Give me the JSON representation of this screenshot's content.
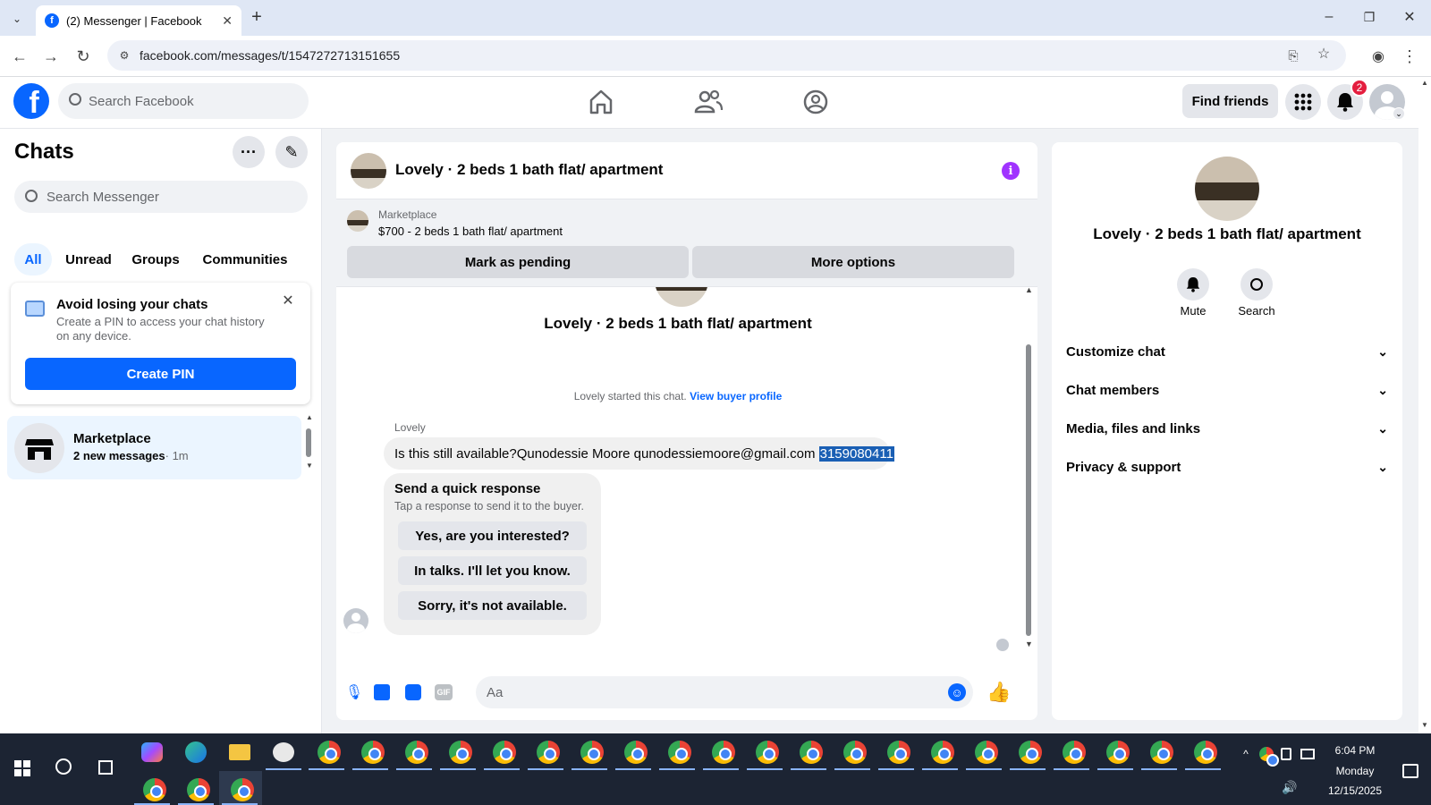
{
  "browser": {
    "tab_title": "(2) Messenger | Facebook",
    "url": "facebook.com/messages/t/1547272713151655"
  },
  "facebook": {
    "search_placeholder": "Search Facebook",
    "find_friends_label": "Find friends",
    "notification_count": "2"
  },
  "chats": {
    "title": "Chats",
    "search_placeholder": "Search Messenger",
    "filters": [
      "All",
      "Unread",
      "Groups",
      "Communities"
    ],
    "pin_card": {
      "title": "Avoid losing your chats",
      "body": "Create a PIN to access your chat history on any device.",
      "button": "Create PIN"
    },
    "conversations": [
      {
        "name": "Marketplace",
        "preview": "2 new messages",
        "time": "· 1m"
      }
    ]
  },
  "conversation": {
    "title": "Lovely · 2 beds 1 bath flat/ apartment",
    "marketplace_label": "Marketplace",
    "listing": "$700 - 2 beds 1 bath flat/ apartment",
    "mark_pending": "Mark as pending",
    "more_options": "More options",
    "intro_title": "Lovely · 2 beds 1 bath flat/ apartment",
    "started_text": "Lovely started this chat.",
    "view_buyer_profile": "View buyer profile",
    "sender_name": "Lovely",
    "message_text": "Is this still available?Qunodessie Moore qunodessiemoore@gmail.com ",
    "message_highlight": "3159080411",
    "quick_response": {
      "title": "Send a quick response",
      "subtitle": "Tap a response to send it to the buyer.",
      "options": [
        "Yes, are you interested?",
        "In talks. I'll let you know.",
        "Sorry, it's not available."
      ]
    },
    "composer_placeholder": "Aa"
  },
  "details": {
    "title": "Lovely · 2 beds 1 bath flat/ apartment",
    "mute_label": "Mute",
    "search_label": "Search",
    "sections": [
      "Customize chat",
      "Chat members",
      "Media, files and links",
      "Privacy & support"
    ]
  },
  "taskbar": {
    "time": "6:04 PM",
    "day": "Monday",
    "date": "12/15/2025"
  },
  "colors": {
    "accent": "#0866ff",
    "info_icon": "#a033ff",
    "badge": "#e41e3f",
    "selection": "#1a5fb4"
  }
}
